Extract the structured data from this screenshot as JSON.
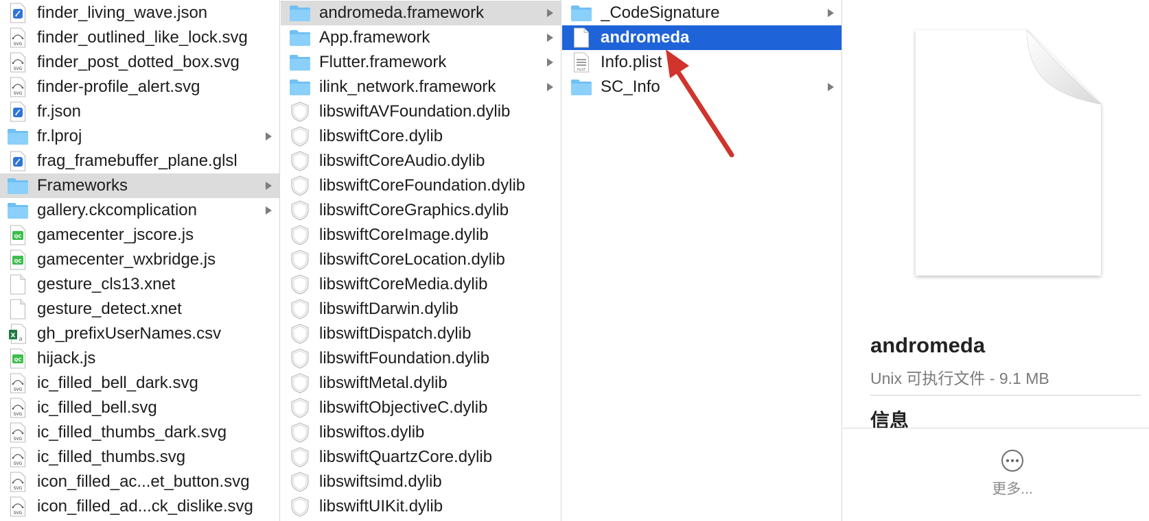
{
  "column1": {
    "items": [
      {
        "label": "finder_living_wave.json",
        "icon": "json-file-icon",
        "folder": false,
        "selected": false
      },
      {
        "label": "finder_outlined_like_lock.svg",
        "icon": "svg-file-icon",
        "folder": false,
        "selected": false
      },
      {
        "label": "finder_post_dotted_box.svg",
        "icon": "svg-file-icon",
        "folder": false,
        "selected": false
      },
      {
        "label": "finder-profile_alert.svg",
        "icon": "svg-file-icon",
        "folder": false,
        "selected": false
      },
      {
        "label": "fr.json",
        "icon": "json-file-icon",
        "folder": false,
        "selected": false
      },
      {
        "label": "fr.lproj",
        "icon": "folder-icon",
        "folder": true,
        "selected": false
      },
      {
        "label": "frag_framebuffer_plane.glsl",
        "icon": "json-file-icon",
        "folder": false,
        "selected": false
      },
      {
        "label": "Frameworks",
        "icon": "folder-icon",
        "folder": true,
        "selected": true
      },
      {
        "label": "gallery.ckcomplication",
        "icon": "folder-icon",
        "folder": true,
        "selected": false
      },
      {
        "label": "gamecenter_jscore.js",
        "icon": "js-file-icon",
        "folder": false,
        "selected": false
      },
      {
        "label": "gamecenter_wxbridge.js",
        "icon": "js-file-icon",
        "folder": false,
        "selected": false
      },
      {
        "label": "gesture_cls13.xnet",
        "icon": "blank-file-icon",
        "folder": false,
        "selected": false
      },
      {
        "label": "gesture_detect.xnet",
        "icon": "blank-file-icon",
        "folder": false,
        "selected": false
      },
      {
        "label": "gh_prefixUserNames.csv",
        "icon": "csv-file-icon",
        "folder": false,
        "selected": false
      },
      {
        "label": "hijack.js",
        "icon": "js-file-icon",
        "folder": false,
        "selected": false
      },
      {
        "label": "ic_filled_bell_dark.svg",
        "icon": "svg-file-icon",
        "folder": false,
        "selected": false
      },
      {
        "label": "ic_filled_bell.svg",
        "icon": "svg-file-icon",
        "folder": false,
        "selected": false
      },
      {
        "label": "ic_filled_thumbs_dark.svg",
        "icon": "svg-file-icon",
        "folder": false,
        "selected": false
      },
      {
        "label": "ic_filled_thumbs.svg",
        "icon": "svg-file-icon",
        "folder": false,
        "selected": false
      },
      {
        "label": "icon_filled_ac...et_button.svg",
        "icon": "svg-file-icon",
        "folder": false,
        "selected": false
      },
      {
        "label": "icon_filled_ad...ck_dislike.svg",
        "icon": "svg-file-icon",
        "folder": false,
        "selected": false
      }
    ]
  },
  "column2": {
    "items": [
      {
        "label": "andromeda.framework",
        "icon": "folder-icon",
        "folder": true,
        "selected": true
      },
      {
        "label": "App.framework",
        "icon": "folder-icon",
        "folder": true,
        "selected": false
      },
      {
        "label": "Flutter.framework",
        "icon": "folder-icon",
        "folder": true,
        "selected": false
      },
      {
        "label": "ilink_network.framework",
        "icon": "folder-icon",
        "folder": true,
        "selected": false
      },
      {
        "label": "libswiftAVFoundation.dylib",
        "icon": "dylib-icon",
        "folder": false,
        "selected": false
      },
      {
        "label": "libswiftCore.dylib",
        "icon": "dylib-icon",
        "folder": false,
        "selected": false
      },
      {
        "label": "libswiftCoreAudio.dylib",
        "icon": "dylib-icon",
        "folder": false,
        "selected": false
      },
      {
        "label": "libswiftCoreFoundation.dylib",
        "icon": "dylib-icon",
        "folder": false,
        "selected": false
      },
      {
        "label": "libswiftCoreGraphics.dylib",
        "icon": "dylib-icon",
        "folder": false,
        "selected": false
      },
      {
        "label": "libswiftCoreImage.dylib",
        "icon": "dylib-icon",
        "folder": false,
        "selected": false
      },
      {
        "label": "libswiftCoreLocation.dylib",
        "icon": "dylib-icon",
        "folder": false,
        "selected": false
      },
      {
        "label": "libswiftCoreMedia.dylib",
        "icon": "dylib-icon",
        "folder": false,
        "selected": false
      },
      {
        "label": "libswiftDarwin.dylib",
        "icon": "dylib-icon",
        "folder": false,
        "selected": false
      },
      {
        "label": "libswiftDispatch.dylib",
        "icon": "dylib-icon",
        "folder": false,
        "selected": false
      },
      {
        "label": "libswiftFoundation.dylib",
        "icon": "dylib-icon",
        "folder": false,
        "selected": false
      },
      {
        "label": "libswiftMetal.dylib",
        "icon": "dylib-icon",
        "folder": false,
        "selected": false
      },
      {
        "label": "libswiftObjectiveC.dylib",
        "icon": "dylib-icon",
        "folder": false,
        "selected": false
      },
      {
        "label": "libswiftos.dylib",
        "icon": "dylib-icon",
        "folder": false,
        "selected": false
      },
      {
        "label": "libswiftQuartzCore.dylib",
        "icon": "dylib-icon",
        "folder": false,
        "selected": false
      },
      {
        "label": "libswiftsimd.dylib",
        "icon": "dylib-icon",
        "folder": false,
        "selected": false
      },
      {
        "label": "libswiftUIKit.dylib",
        "icon": "dylib-icon",
        "folder": false,
        "selected": false
      }
    ]
  },
  "column3": {
    "items": [
      {
        "label": "_CodeSignature",
        "icon": "folder-icon",
        "folder": true,
        "selected": false
      },
      {
        "label": "andromeda",
        "icon": "blank-file-icon",
        "folder": false,
        "selected": true
      },
      {
        "label": "Info.plist",
        "icon": "plist-file-icon",
        "folder": false,
        "selected": false
      },
      {
        "label": "SC_Info",
        "icon": "folder-icon",
        "folder": true,
        "selected": false
      }
    ]
  },
  "preview": {
    "title": "andromeda",
    "subtitle": "Unix 可执行文件 - 9.1 MB",
    "section": "信息",
    "more_label": "更多..."
  },
  "colors": {
    "selection_blue": "#1f63d8",
    "selection_gray": "#dcdcdc",
    "folder_blue": "#6cbcf0",
    "annotation_arrow": "#d0342c"
  }
}
